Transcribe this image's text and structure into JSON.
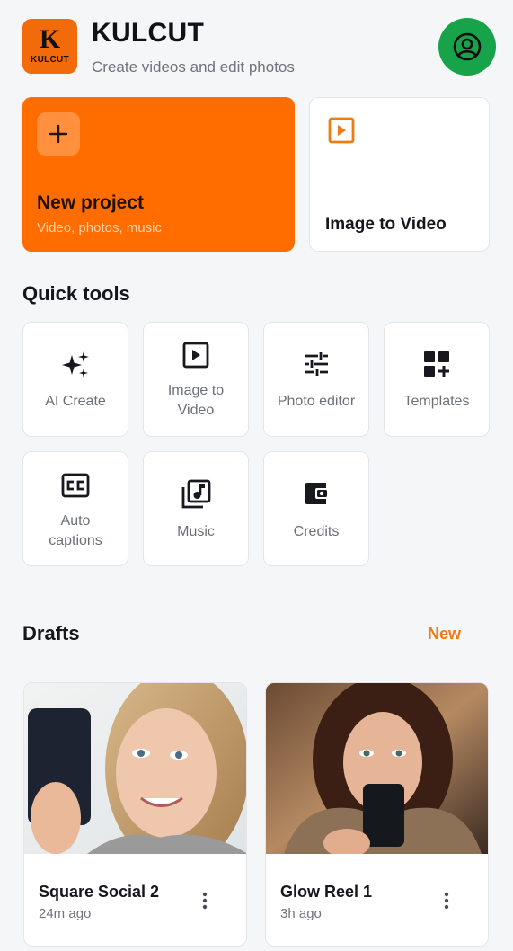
{
  "app": {
    "logo_letter": "K",
    "logo_wordmark": "KULCUT",
    "title": "KULCUT",
    "subtitle": "Create videos and edit photos"
  },
  "hero": {
    "new_project": {
      "title": "New project",
      "subtitle": "Video, photos, music",
      "icon": "plus-icon"
    },
    "image_to_video": {
      "title": "Image to Video",
      "icon": "play-square-icon"
    }
  },
  "quick_tools": {
    "title": "Quick tools",
    "items": [
      {
        "label": "AI Create",
        "icon": "sparkles-icon"
      },
      {
        "label": "Image to Video",
        "icon": "play-square-icon"
      },
      {
        "label": "Photo editor",
        "icon": "sliders-icon"
      },
      {
        "label": "Templates",
        "icon": "grid-plus-icon"
      },
      {
        "label": "Auto captions",
        "icon": "closed-captions-icon"
      },
      {
        "label": "Music",
        "icon": "music-library-icon"
      },
      {
        "label": "Credits",
        "icon": "wallet-icon"
      }
    ]
  },
  "drafts": {
    "title": "Drafts",
    "new_label": "New",
    "items": [
      {
        "title": "Square Social 2",
        "time": "24m ago"
      },
      {
        "title": "Glow Reel 1",
        "time": "3h ago"
      }
    ]
  },
  "colors": {
    "accent": "#ff6d00",
    "profile": "#16a34a",
    "link": "#ee7c12",
    "background": "#f5f6f8"
  }
}
